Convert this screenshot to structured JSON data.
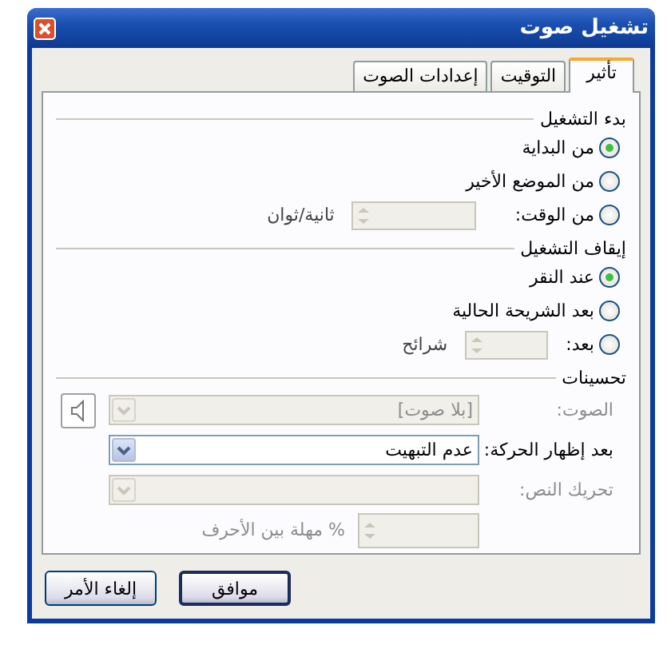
{
  "window": {
    "title": "تشغيل صوت"
  },
  "tabs": [
    {
      "label": "تأثير",
      "selected": true
    },
    {
      "label": "التوقيت",
      "selected": false
    },
    {
      "label": "إعدادات الصوت",
      "selected": false
    }
  ],
  "sections": [
    {
      "heading": "بدء التشغيل",
      "options": [
        {
          "label": "من البداية",
          "selected": true
        },
        {
          "label": "من الموضع الأخير",
          "selected": false
        },
        {
          "label": "من الوقت:",
          "selected": false,
          "spinner": {
            "disabled": true,
            "unit": "ثانية/ثوان"
          }
        }
      ]
    },
    {
      "heading": "إيقاف التشغيل",
      "options": [
        {
          "label": "عند النقر",
          "selected": true
        },
        {
          "label": "بعد الشريحة الحالية",
          "selected": false
        },
        {
          "label": "بعد:",
          "selected": false,
          "spinner": {
            "disabled": true,
            "unit": "شرائح"
          }
        }
      ]
    }
  ],
  "enhancements": {
    "heading": "تحسينات",
    "rows": [
      {
        "kind": "dropdown",
        "label": "الصوت:",
        "value": "[بلا صوت]",
        "disabled": true,
        "speaker_button": true
      },
      {
        "kind": "dropdown",
        "label": "بعد إظهار الحركة:",
        "value": "عدم التبهيت",
        "disabled": false
      },
      {
        "kind": "dropdown",
        "label": "تحريك النص:",
        "disabled": true
      },
      {
        "kind": "spinner",
        "unit": "% مهلة بين الأحرف",
        "disabled": true
      }
    ]
  },
  "buttons": [
    {
      "label": "موافق",
      "default": true
    },
    {
      "label": "إلغاء الأمر",
      "default": false
    }
  ]
}
